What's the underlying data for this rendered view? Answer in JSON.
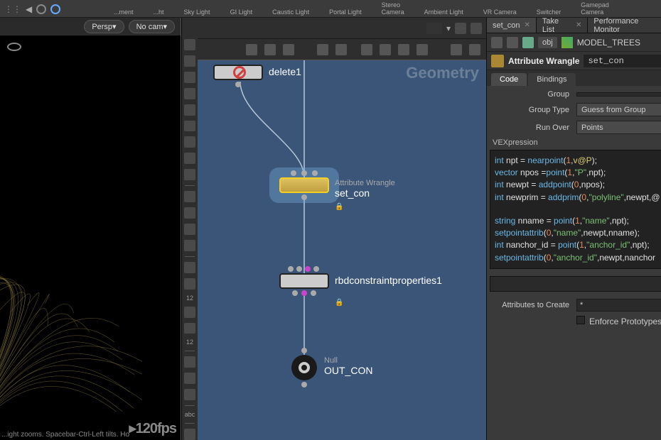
{
  "shelf": {
    "items": [
      {
        "label": "...ment"
      },
      {
        "label": "...ht"
      },
      {
        "label": "Sky Light"
      },
      {
        "label": "GI Light"
      },
      {
        "label": "Caustic Light"
      },
      {
        "label": "Portal Light"
      },
      {
        "label": "Stereo\nCamera"
      },
      {
        "label": "Ambient Light"
      },
      {
        "label": "VR Camera"
      },
      {
        "label": "Switcher"
      },
      {
        "label": "Gamepad\nCamera"
      }
    ]
  },
  "viewport": {
    "persp": "Persp▾",
    "cam": "No cam▾",
    "status": "...ight zooms. Spacebar-Ctrl-Left tilts. Ho",
    "fps": "▸120fps"
  },
  "network": {
    "context": "Geometry",
    "nodes": {
      "delete": {
        "name": "delete1"
      },
      "wrangle": {
        "type": "Attribute Wrangle",
        "name": "set_con"
      },
      "rbd": {
        "name": "rbdconstraintproperties1"
      },
      "null": {
        "type": "Null",
        "name": "OUT_CON"
      }
    }
  },
  "rp": {
    "tabs": [
      {
        "label": "set_con",
        "active": true
      },
      {
        "label": "Take List"
      },
      {
        "label": "Performance Monitor"
      }
    ],
    "path": {
      "level": "obj",
      "node": "MODEL_TREES"
    },
    "op": {
      "type": "Attribute Wrangle",
      "name": "set_con"
    },
    "subtabs": [
      {
        "label": "Code",
        "active": true
      },
      {
        "label": "Bindings"
      }
    ],
    "params": {
      "group_label": "Group",
      "group_value": "",
      "grouptype_label": "Group Type",
      "grouptype_value": "Guess from Group",
      "runover_label": "Run Over",
      "runover_value": "Points",
      "vex_label": "VEXpression",
      "attrs_label": "Attributes to Create",
      "attrs_value": "*",
      "enforce_label": "Enforce Prototypes"
    },
    "code_lines": [
      [
        [
          "kw",
          "int"
        ],
        [
          "id",
          " npt = "
        ],
        [
          "fn",
          "nearpoint"
        ],
        [
          "id",
          "("
        ],
        [
          "num",
          "1"
        ],
        [
          "id",
          ","
        ],
        [
          "at",
          "v@P"
        ],
        [
          "id",
          ");"
        ]
      ],
      [
        [
          "kw",
          "vector"
        ],
        [
          "id",
          " npos ="
        ],
        [
          "fn",
          "point"
        ],
        [
          "id",
          "("
        ],
        [
          "num",
          "1"
        ],
        [
          "id",
          ","
        ],
        [
          "str",
          "\"P\""
        ],
        [
          "id",
          ",npt);"
        ]
      ],
      [
        [
          "kw",
          "int"
        ],
        [
          "id",
          " newpt = "
        ],
        [
          "fn",
          "addpoint"
        ],
        [
          "id",
          "("
        ],
        [
          "num",
          "0"
        ],
        [
          "id",
          ",npos);"
        ]
      ],
      [
        [
          "kw",
          "int"
        ],
        [
          "id",
          " newprim = "
        ],
        [
          "fn",
          "addprim"
        ],
        [
          "id",
          "("
        ],
        [
          "num",
          "0"
        ],
        [
          "id",
          ","
        ],
        [
          "str",
          "\"polyline\""
        ],
        [
          "id",
          ",newpt,@"
        ]
      ],
      [],
      [
        [
          "kw",
          "string"
        ],
        [
          "id",
          " nname = "
        ],
        [
          "fn",
          "point"
        ],
        [
          "id",
          "("
        ],
        [
          "num",
          "1"
        ],
        [
          "id",
          ","
        ],
        [
          "str",
          "\"name\""
        ],
        [
          "id",
          ",npt);"
        ]
      ],
      [
        [
          "fn",
          "setpointattrib"
        ],
        [
          "id",
          "("
        ],
        [
          "num",
          "0"
        ],
        [
          "id",
          ","
        ],
        [
          "str",
          "\"name\""
        ],
        [
          "id",
          ",newpt,nname);"
        ]
      ],
      [
        [
          "kw",
          "int"
        ],
        [
          "id",
          " nanchor_id = "
        ],
        [
          "fn",
          "point"
        ],
        [
          "id",
          "("
        ],
        [
          "num",
          "1"
        ],
        [
          "id",
          ","
        ],
        [
          "str",
          "\"anchor_id\""
        ],
        [
          "id",
          ",npt);"
        ]
      ],
      [
        [
          "fn",
          "setpointattrib"
        ],
        [
          "id",
          "("
        ],
        [
          "num",
          "0"
        ],
        [
          "id",
          ","
        ],
        [
          "str",
          "\"anchor_id\""
        ],
        [
          "id",
          ",newpt,nanchor"
        ]
      ]
    ]
  }
}
